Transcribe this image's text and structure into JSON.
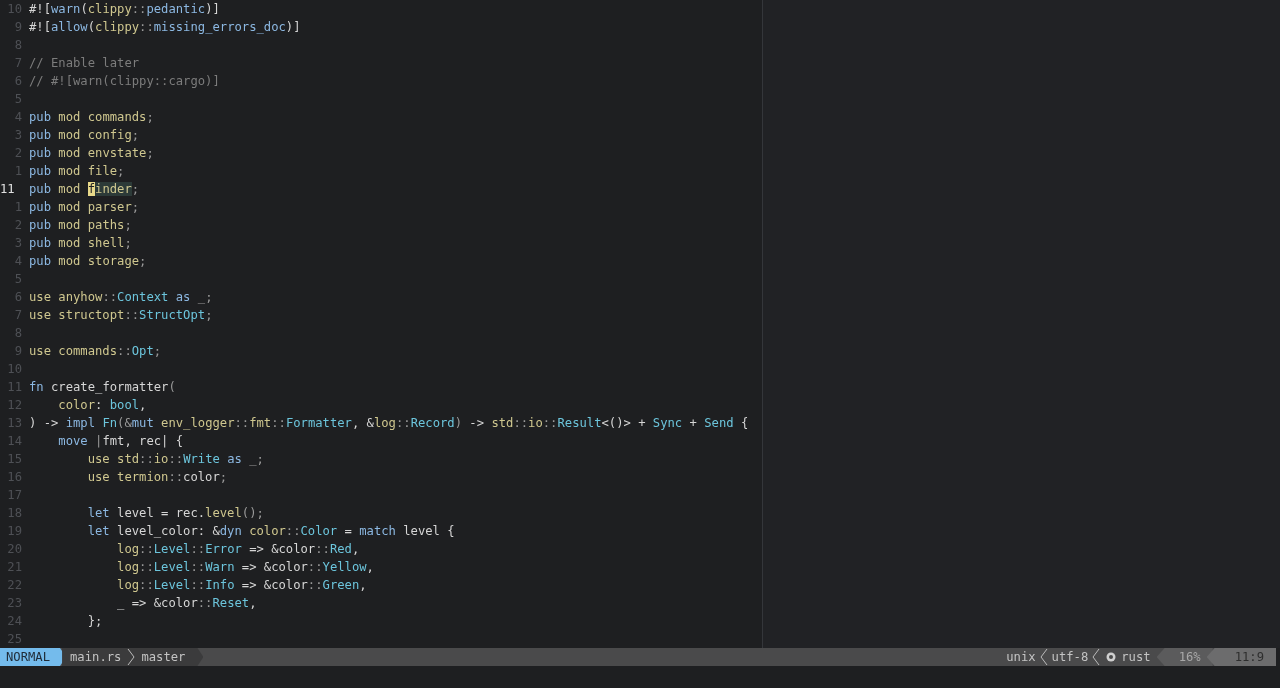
{
  "editor": {
    "lines": [
      {
        "number": "10",
        "current": false,
        "tokens": [
          {
            "kind": "id",
            "text": "#!["
          },
          {
            "kind": "kw",
            "text": "warn"
          },
          {
            "kind": "id",
            "text": "("
          },
          {
            "kind": "kw2",
            "text": "clippy"
          },
          {
            "kind": "p",
            "text": "::"
          },
          {
            "kind": "kw",
            "text": "pedantic"
          },
          {
            "kind": "id",
            "text": ")]"
          }
        ]
      },
      {
        "number": "9",
        "current": false,
        "tokens": [
          {
            "kind": "id",
            "text": "#!["
          },
          {
            "kind": "kw",
            "text": "allow"
          },
          {
            "kind": "id",
            "text": "("
          },
          {
            "kind": "kw2",
            "text": "clippy"
          },
          {
            "kind": "p",
            "text": "::"
          },
          {
            "kind": "kw",
            "text": "missing_errors_doc"
          },
          {
            "kind": "id",
            "text": ")]"
          }
        ]
      },
      {
        "number": "8",
        "current": false
      },
      {
        "number": "7",
        "current": false,
        "tokens": [
          {
            "kind": "c",
            "text": "// Enable later"
          }
        ]
      },
      {
        "number": "6",
        "current": false,
        "tokens": [
          {
            "kind": "c",
            "text": "// #![warn(clippy::cargo)]"
          }
        ]
      },
      {
        "number": "5",
        "current": false
      },
      {
        "number": "4",
        "current": false,
        "tokens": [
          {
            "kind": "kw",
            "text": "pub"
          },
          {
            "kind": "kw2",
            "text": " mod commands"
          },
          {
            "kind": "p",
            "text": ";"
          }
        ]
      },
      {
        "number": "3",
        "current": false,
        "tokens": [
          {
            "kind": "kw",
            "text": "pub"
          },
          {
            "kind": "kw2",
            "text": " mod config"
          },
          {
            "kind": "p",
            "text": ";"
          }
        ]
      },
      {
        "number": "2",
        "current": false,
        "tokens": [
          {
            "kind": "kw",
            "text": "pub"
          },
          {
            "kind": "kw2",
            "text": " mod envstate"
          },
          {
            "kind": "p",
            "text": ";"
          }
        ]
      },
      {
        "number": "1",
        "current": false,
        "tokens": [
          {
            "kind": "kw",
            "text": "pub"
          },
          {
            "kind": "kw2",
            "text": " mod file"
          },
          {
            "kind": "p",
            "text": ";"
          }
        ]
      },
      {
        "number": "11",
        "current": true,
        "tokens": [
          {
            "kind": "kw",
            "text": "pub"
          },
          {
            "kind": "kw2",
            "text": " mod "
          },
          {
            "kind": "cursor",
            "text": "f"
          },
          {
            "kind": "match",
            "text": "inder"
          },
          {
            "kind": "p",
            "text": ";"
          }
        ]
      },
      {
        "number": "1",
        "current": false,
        "tokens": [
          {
            "kind": "kw",
            "text": "pub"
          },
          {
            "kind": "kw2",
            "text": " mod parser"
          },
          {
            "kind": "p",
            "text": ";"
          }
        ]
      },
      {
        "number": "2",
        "current": false,
        "tokens": [
          {
            "kind": "kw",
            "text": "pub"
          },
          {
            "kind": "kw2",
            "text": " mod paths"
          },
          {
            "kind": "p",
            "text": ";"
          }
        ]
      },
      {
        "number": "3",
        "current": false,
        "tokens": [
          {
            "kind": "kw",
            "text": "pub"
          },
          {
            "kind": "kw2",
            "text": " mod shell"
          },
          {
            "kind": "p",
            "text": ";"
          }
        ]
      },
      {
        "number": "4",
        "current": false,
        "tokens": [
          {
            "kind": "kw",
            "text": "pub"
          },
          {
            "kind": "kw2",
            "text": " mod storage"
          },
          {
            "kind": "p",
            "text": ";"
          }
        ]
      },
      {
        "number": "5",
        "current": false
      },
      {
        "number": "6",
        "current": false,
        "tokens": [
          {
            "kind": "kw2",
            "text": "use anyhow"
          },
          {
            "kind": "p",
            "text": "::"
          },
          {
            "kind": "ty",
            "text": "Context"
          },
          {
            "kind": "kw",
            "text": " as"
          },
          {
            "kind": "p",
            "text": " _;"
          }
        ]
      },
      {
        "number": "7",
        "current": false,
        "tokens": [
          {
            "kind": "kw2",
            "text": "use structopt"
          },
          {
            "kind": "p",
            "text": "::"
          },
          {
            "kind": "ty",
            "text": "StructOpt"
          },
          {
            "kind": "p",
            "text": ";"
          }
        ]
      },
      {
        "number": "8",
        "current": false
      },
      {
        "number": "9",
        "current": false,
        "tokens": [
          {
            "kind": "kw2",
            "text": "use commands"
          },
          {
            "kind": "p",
            "text": "::"
          },
          {
            "kind": "ty",
            "text": "Opt"
          },
          {
            "kind": "p",
            "text": ";"
          }
        ]
      },
      {
        "number": "10",
        "current": false
      },
      {
        "number": "11",
        "current": false,
        "tokens": [
          {
            "kind": "kw",
            "text": "fn"
          },
          {
            "kind": "id",
            "text": " create_formatter"
          },
          {
            "kind": "p",
            "text": "("
          }
        ]
      },
      {
        "number": "12",
        "current": false,
        "tokens": [
          {
            "kind": "kw2",
            "text": "    color"
          },
          {
            "kind": "id",
            "text": ": "
          },
          {
            "kind": "ty",
            "text": "bool"
          },
          {
            "kind": "id",
            "text": ","
          }
        ]
      },
      {
        "number": "13",
        "current": false,
        "tokens": [
          {
            "kind": "id",
            "text": ") -> "
          },
          {
            "kind": "kw",
            "text": "impl "
          },
          {
            "kind": "ty",
            "text": "Fn"
          },
          {
            "kind": "p",
            "text": "(&"
          },
          {
            "kind": "kw",
            "text": "mut"
          },
          {
            "kind": "kw2",
            "text": " env_logger"
          },
          {
            "kind": "p",
            "text": "::"
          },
          {
            "kind": "kw2",
            "text": "fmt"
          },
          {
            "kind": "p",
            "text": "::"
          },
          {
            "kind": "ty",
            "text": "Formatter"
          },
          {
            "kind": "id",
            "text": ", &"
          },
          {
            "kind": "kw2",
            "text": "log"
          },
          {
            "kind": "p",
            "text": "::"
          },
          {
            "kind": "ty",
            "text": "Record"
          },
          {
            "kind": "p",
            "text": ")"
          },
          {
            "kind": "id",
            "text": " -> "
          },
          {
            "kind": "kw2",
            "text": "std"
          },
          {
            "kind": "p",
            "text": "::"
          },
          {
            "kind": "kw2",
            "text": "io"
          },
          {
            "kind": "p",
            "text": "::"
          },
          {
            "kind": "ty",
            "text": "Result"
          },
          {
            "kind": "id",
            "text": "<()> + "
          },
          {
            "kind": "ty",
            "text": "Sync"
          },
          {
            "kind": "id",
            "text": " + "
          },
          {
            "kind": "ty",
            "text": "Send"
          },
          {
            "kind": "id",
            "text": " {"
          }
        ]
      },
      {
        "number": "14",
        "current": false,
        "tokens": [
          {
            "kind": "kw",
            "text": "    move"
          },
          {
            "kind": "p",
            "text": " |"
          },
          {
            "kind": "id",
            "text": "fmt, rec| {"
          }
        ]
      },
      {
        "number": "15",
        "current": false,
        "tokens": [
          {
            "kind": "kw2",
            "text": "        use std"
          },
          {
            "kind": "p",
            "text": "::"
          },
          {
            "kind": "kw2",
            "text": "io"
          },
          {
            "kind": "p",
            "text": "::"
          },
          {
            "kind": "ty",
            "text": "Write"
          },
          {
            "kind": "kw",
            "text": " as"
          },
          {
            "kind": "p",
            "text": " _;"
          }
        ]
      },
      {
        "number": "16",
        "current": false,
        "tokens": [
          {
            "kind": "kw2",
            "text": "        use termion"
          },
          {
            "kind": "p",
            "text": "::"
          },
          {
            "kind": "id",
            "text": "color"
          },
          {
            "kind": "p",
            "text": ";"
          }
        ]
      },
      {
        "number": "17",
        "current": false
      },
      {
        "number": "18",
        "current": false,
        "tokens": [
          {
            "kind": "kw",
            "text": "        let"
          },
          {
            "kind": "id",
            "text": " level = rec."
          },
          {
            "kind": "kw2",
            "text": "level"
          },
          {
            "kind": "p",
            "text": "();"
          }
        ]
      },
      {
        "number": "19",
        "current": false,
        "tokens": [
          {
            "kind": "kw",
            "text": "        let"
          },
          {
            "kind": "id",
            "text": " level_color: &"
          },
          {
            "kind": "kw",
            "text": "dyn"
          },
          {
            "kind": "kw2",
            "text": " color"
          },
          {
            "kind": "p",
            "text": "::"
          },
          {
            "kind": "ty",
            "text": "Color"
          },
          {
            "kind": "id",
            "text": " = "
          },
          {
            "kind": "kw",
            "text": "match"
          },
          {
            "kind": "id",
            "text": " level {"
          }
        ]
      },
      {
        "number": "20",
        "current": false,
        "tokens": [
          {
            "kind": "kw2",
            "text": "            log"
          },
          {
            "kind": "p",
            "text": "::"
          },
          {
            "kind": "ty",
            "text": "Level"
          },
          {
            "kind": "p",
            "text": "::"
          },
          {
            "kind": "ty",
            "text": "Error"
          },
          {
            "kind": "id",
            "text": " => &color"
          },
          {
            "kind": "p",
            "text": "::"
          },
          {
            "kind": "ty",
            "text": "Red"
          },
          {
            "kind": "id",
            "text": ","
          }
        ]
      },
      {
        "number": "21",
        "current": false,
        "tokens": [
          {
            "kind": "kw2",
            "text": "            log"
          },
          {
            "kind": "p",
            "text": "::"
          },
          {
            "kind": "ty",
            "text": "Level"
          },
          {
            "kind": "p",
            "text": "::"
          },
          {
            "kind": "ty",
            "text": "Warn"
          },
          {
            "kind": "id",
            "text": " => &color"
          },
          {
            "kind": "p",
            "text": "::"
          },
          {
            "kind": "ty",
            "text": "Yellow"
          },
          {
            "kind": "id",
            "text": ","
          }
        ]
      },
      {
        "number": "22",
        "current": false,
        "tokens": [
          {
            "kind": "kw2",
            "text": "            log"
          },
          {
            "kind": "p",
            "text": "::"
          },
          {
            "kind": "ty",
            "text": "Level"
          },
          {
            "kind": "p",
            "text": "::"
          },
          {
            "kind": "ty",
            "text": "Info"
          },
          {
            "kind": "id",
            "text": " => &color"
          },
          {
            "kind": "p",
            "text": "::"
          },
          {
            "kind": "ty",
            "text": "Green"
          },
          {
            "kind": "id",
            "text": ","
          }
        ]
      },
      {
        "number": "23",
        "current": false,
        "tokens": [
          {
            "kind": "id",
            "text": "            _ => &color"
          },
          {
            "kind": "p",
            "text": "::"
          },
          {
            "kind": "ty",
            "text": "Reset"
          },
          {
            "kind": "id",
            "text": ","
          }
        ]
      },
      {
        "number": "24",
        "current": false,
        "tokens": [
          {
            "kind": "id",
            "text": "        };"
          }
        ]
      },
      {
        "number": "25",
        "current": false
      }
    ]
  },
  "status_bar": {
    "mode": "NORMAL",
    "file": "main.rs",
    "branch": "master",
    "fileformat": "unix",
    "encoding": "utf-8",
    "filetype": "rust",
    "percent": "16%",
    "position": "11:9"
  }
}
